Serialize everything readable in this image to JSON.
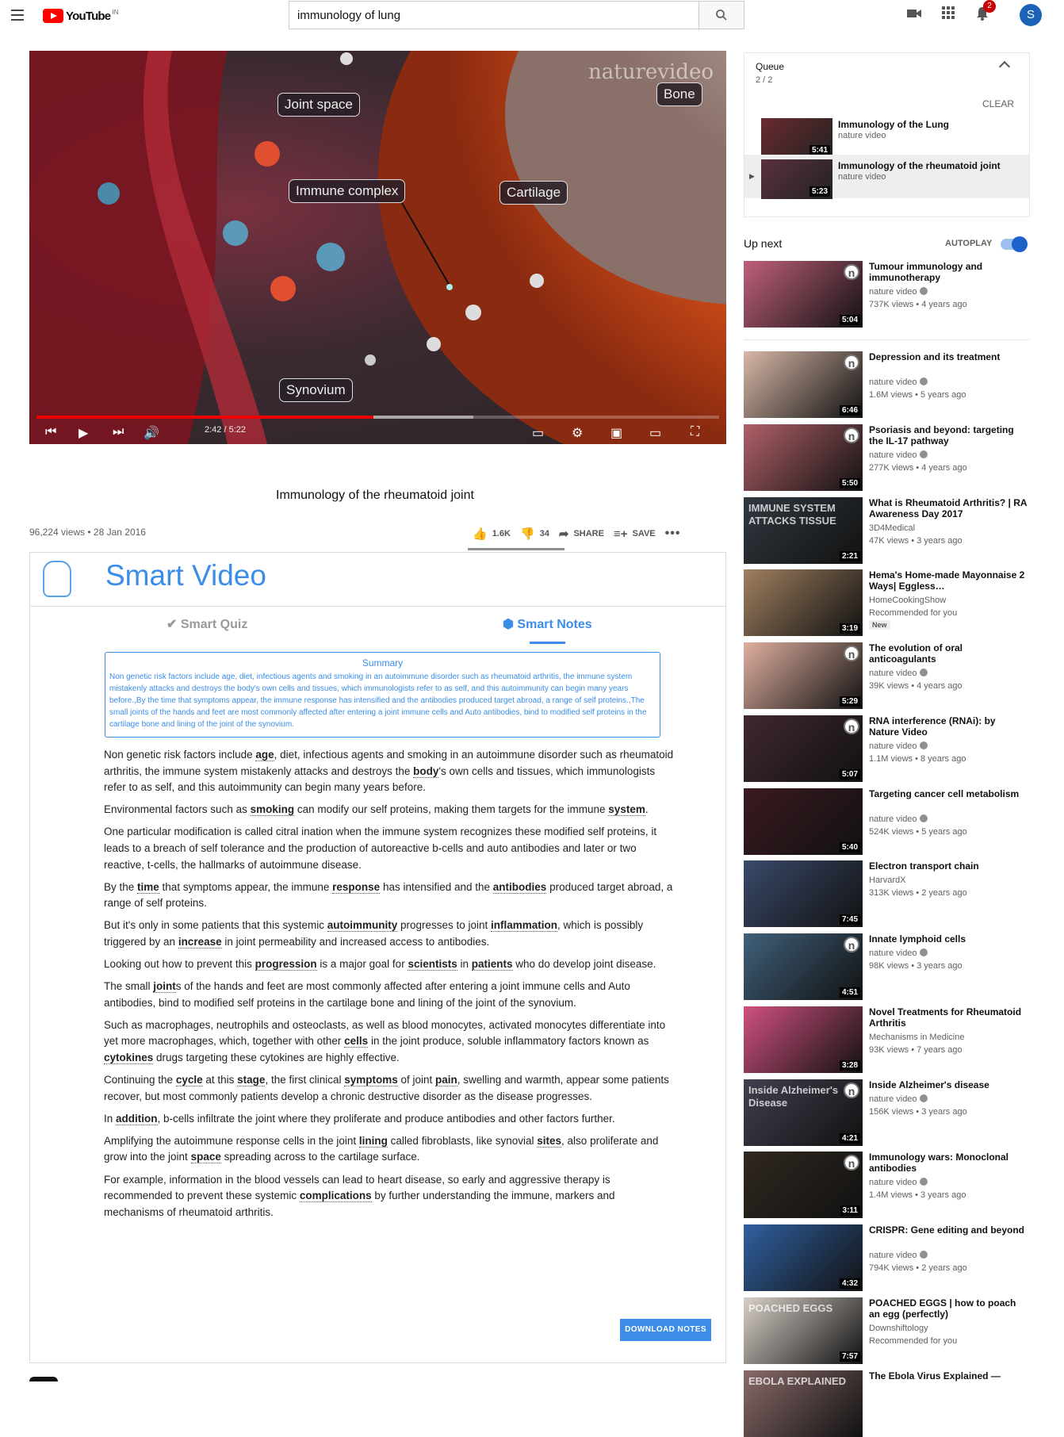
{
  "header": {
    "logo_text": "YouTube",
    "logo_region": "IN",
    "search_value": "immunology of lung",
    "notification_count": "2",
    "avatar_letter": "S"
  },
  "player": {
    "time": "2:42 / 5:22",
    "progress_fraction": 0.4935,
    "buffered_fraction": 0.64,
    "brand": "naturevideo",
    "labels": {
      "joint_space": "Joint space",
      "bone": "Bone",
      "immune_complex": "Immune complex",
      "cartilage": "Cartilage",
      "synovium": "Synovium"
    }
  },
  "video": {
    "title": "Immunology of the rheumatoid joint",
    "views_date": "96,224 views • 28 Jan 2016",
    "likes": "1.6K",
    "dislikes": "34",
    "share": "SHARE",
    "save": "SAVE"
  },
  "smart": {
    "title": "Smart Video",
    "tab_quiz": "Smart Quiz",
    "tab_notes": "Smart Notes",
    "summary_heading": "Summary",
    "summary_text": "Non genetic risk factors include age, diet, infectious agents and smoking in an autoimmune disorder such as rheumatoid arthritis, the immune system mistakenly attacks and destroys the body's own cells and tissues, which immunologists refer to as self, and this autoimmunity can begin many years before.,By the time that symptoms appear, the immune response has intensified and the antibodies produced target abroad, a range of self proteins.,The small joints of the hands and feet are most commonly affected after entering a joint immune cells and Auto antibodies, bind to modified self proteins in the cartilage bone and lining of the joint of the synovium.",
    "download": "DOWNLOAD NOTES"
  },
  "notes": [
    [
      "Non genetic risk factors include ",
      {
        "k": "age"
      },
      ", diet, infectious agents and smoking in an autoimmune disorder such as rheumatoid arthritis, the immune system mistakenly attacks and destroys the ",
      {
        "k": "body"
      },
      "'s own cells and tissues, which immunologists refer to as self, and this autoimmunity can begin many years before."
    ],
    [
      "Environmental factors such as ",
      {
        "k": "smoking"
      },
      " can modify our self proteins, making them targets for the immune ",
      {
        "k": "system"
      },
      "."
    ],
    [
      "One particular modification is called citral ination when the immune system recognizes these modified self proteins, it leads to a breach of self tolerance and the production of autoreactive b-cells and auto antibodies and later or two reactive, t-cells, the hallmarks of autoimmune disease."
    ],
    [
      "By the ",
      {
        "k": "time"
      },
      " that symptoms appear, the immune ",
      {
        "k": "response"
      },
      " has intensified and the ",
      {
        "k": "antibodies"
      },
      " produced target abroad, a range of self proteins."
    ],
    [
      "But it's only in some patients that this systemic ",
      {
        "k": "autoimmunity"
      },
      " progresses to joint ",
      {
        "k": "inflammation"
      },
      ", which is possibly triggered by an ",
      {
        "k": "increase"
      },
      " in joint permeability and increased access to antibodies."
    ],
    [
      "Looking out how to prevent this ",
      {
        "k": "progression"
      },
      " is a major goal for ",
      {
        "k": "scientists"
      },
      " in ",
      {
        "k": "patients"
      },
      " who do develop joint disease."
    ],
    [
      "The small ",
      {
        "k": "joint"
      },
      "s of the hands and feet are most commonly affected after entering a joint immune cells and Auto antibodies, bind to modified self proteins in the cartilage bone and lining of the joint of the synovium."
    ],
    [
      "Such as macrophages, neutrophils and osteoclasts, as well as blood monocytes, activated monocytes differentiate into yet more macrophages, which, together with other ",
      {
        "k": "cells"
      },
      " in the joint produce, soluble inflammatory factors known as ",
      {
        "k": "cytokines"
      },
      " drugs targeting these cytokines are highly effective."
    ],
    [
      "Continuing the ",
      {
        "k": "cycle"
      },
      " at this ",
      {
        "k": "stage"
      },
      ", the first clinical ",
      {
        "k": "symptoms"
      },
      " of joint ",
      {
        "k": "pain"
      },
      ", swelling and warmth, appear some patients recover, but most commonly patients develop a chronic destructive disorder as the disease progresses."
    ],
    [
      "In ",
      {
        "k": "addition"
      },
      ", b-cells infiltrate the joint where they proliferate and produce antibodies and other factors further."
    ],
    [
      "Amplifying the autoimmune response cells in the joint ",
      {
        "k": "lining"
      },
      " called fibroblasts, like synovial ",
      {
        "k": "sites"
      },
      ", also proliferate and grow into the joint ",
      {
        "k": "space"
      },
      " spreading across to the cartilage surface."
    ],
    [
      "For example, information in the blood vessels can lead to heart disease, so early and aggressive therapy is recommended to prevent these systemic ",
      {
        "k": "complications"
      },
      " by further understanding the immune, markers and mechanisms of rheumatoid arthritis."
    ]
  ],
  "queue": {
    "title": "Queue",
    "count": "2 / 2",
    "clear": "CLEAR",
    "items": [
      {
        "title": "Immunology of the Lung",
        "channel": "nature video",
        "duration": "5:41",
        "color": "#6a2a30"
      },
      {
        "title": "Immunology of the rheumatoid joint",
        "channel": "nature video",
        "duration": "5:23",
        "color": "#5a3040"
      }
    ]
  },
  "upnext": {
    "label": "Up next",
    "autoplay": "AUTOPLAY"
  },
  "recs": [
    {
      "title": "Tumour immunology and immunotherapy",
      "channel": "nature video",
      "meta": "737K views • 4 years ago",
      "duration": "5:04",
      "color": "#c0607a",
      "logo": true,
      "verified": true
    },
    {
      "title": "Depression and its treatment",
      "channel": "nature video",
      "meta": "1.6M views • 5 years ago",
      "duration": "6:46",
      "color": "#d8b8a8",
      "logo": true,
      "verified": true
    },
    {
      "title": "Psoriasis and beyond: targeting the IL-17 pathway",
      "channel": "nature video",
      "meta": "277K views • 4 years ago",
      "duration": "5:50",
      "color": "#b06068",
      "logo": true,
      "verified": true
    },
    {
      "title": "What is Rheumatoid Arthritis? | RA Awareness Day 2017",
      "channel": "3D4Medical",
      "meta": "47K views • 3 years ago",
      "duration": "2:21",
      "color": "#303840",
      "overlay": "IMMUNE SYSTEM ATTACKS TISSUE"
    },
    {
      "title": "Hema's Home-made Mayonnaise 2 Ways| Eggless…",
      "channel": "HomeCookingShow",
      "meta": "Recommended for you",
      "duration": "3:19",
      "color": "#a08060",
      "badge": "New"
    },
    {
      "title": "The evolution of oral anticoagulants",
      "channel": "nature video",
      "meta": "39K views • 4 years ago",
      "duration": "5:29",
      "color": "#e0b0a0",
      "logo": true,
      "verified": true
    },
    {
      "title": "RNA interference (RNAi): by Nature Video",
      "channel": "nature video",
      "meta": "1.1M views • 8 years ago",
      "duration": "5:07",
      "color": "#402830",
      "logo": true,
      "verified": true
    },
    {
      "title": "Targeting cancer cell metabolism",
      "channel": "nature video",
      "meta": "524K views • 5 years ago",
      "duration": "5:40",
      "color": "#3a1a20",
      "verified": true
    },
    {
      "title": "Electron transport chain",
      "channel": "HarvardX",
      "meta": "313K views • 2 years ago",
      "duration": "7:45",
      "color": "#3a4a6a"
    },
    {
      "title": "Innate lymphoid cells",
      "channel": "nature video",
      "meta": "98K views • 3 years ago",
      "duration": "4:51",
      "color": "#40607a",
      "logo": true,
      "verified": true
    },
    {
      "title": "Novel Treatments for Rheumatoid Arthritis",
      "channel": "Mechanisms in Medicine",
      "meta": "93K views • 7 years ago",
      "duration": "3:28",
      "color": "#d05080"
    },
    {
      "title": "Inside Alzheimer's disease",
      "channel": "nature video",
      "meta": "156K views • 3 years ago",
      "duration": "4:21",
      "color": "#404050",
      "logo": true,
      "verified": true,
      "overlay": "Inside Alzheimer's Disease"
    },
    {
      "title": "Immunology wars: Monoclonal antibodies",
      "channel": "nature video",
      "meta": "1.4M views • 3 years ago",
      "duration": "3:11",
      "color": "#302820",
      "logo": true,
      "verified": true
    },
    {
      "title": "CRISPR: Gene editing and beyond",
      "channel": "nature video",
      "meta": "794K views • 2 years ago",
      "duration": "4:32",
      "color": "#3060a0",
      "verified": true
    },
    {
      "title": "POACHED EGGS | how to poach an egg (perfectly)",
      "channel": "Downshiftology",
      "meta": "Recommended for you",
      "duration": "7:57",
      "color": "#d8d0c8",
      "overlay": "POACHED EGGS"
    },
    {
      "title": "The Ebola Virus Explained —",
      "channel": "",
      "meta": "",
      "duration": "",
      "color": "#8a6a6a",
      "overlay": "EBOLA EXPLAINED"
    }
  ]
}
